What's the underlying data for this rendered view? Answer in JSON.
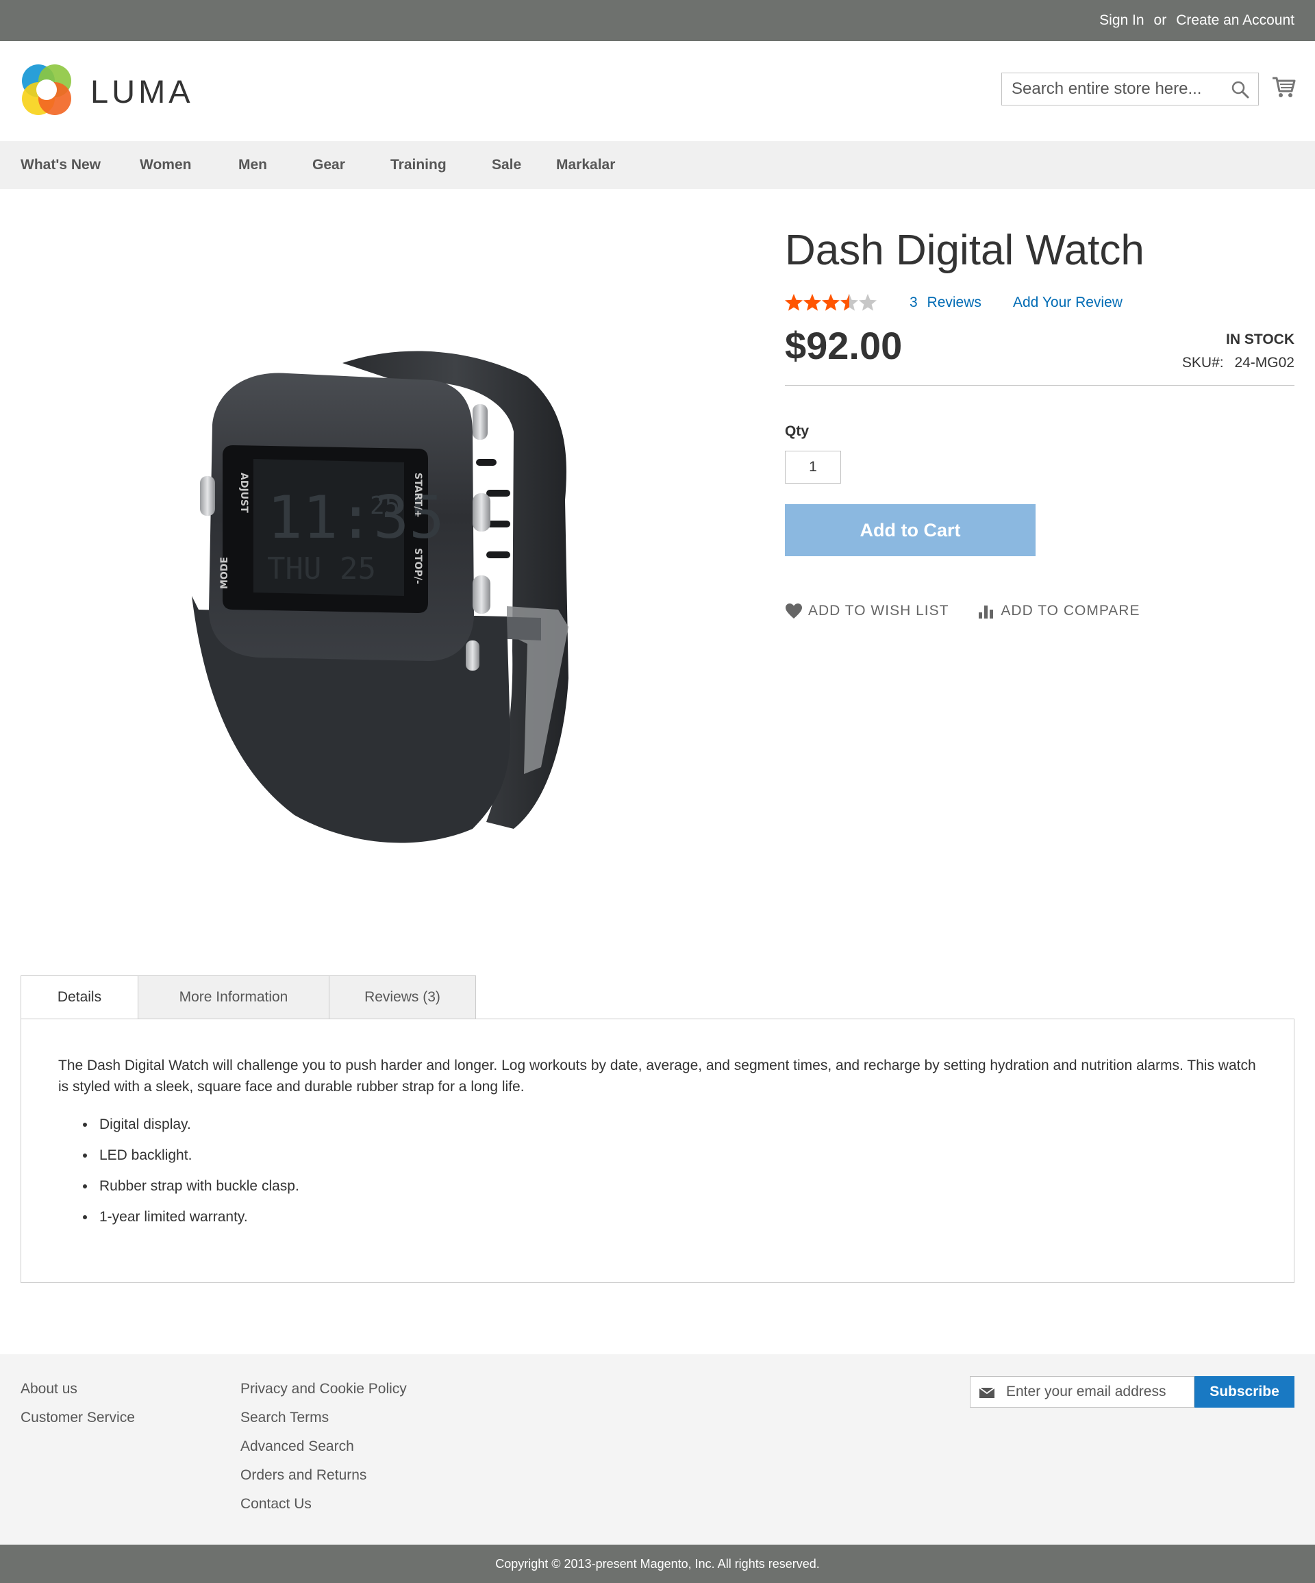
{
  "top_panel": {
    "sign_in": "Sign In",
    "or": "or",
    "create_account": "Create an Account"
  },
  "header": {
    "logo_text": "LUMA",
    "search_placeholder": "Search entire store here...",
    "search_icon": "search-icon",
    "cart_icon": "cart-icon"
  },
  "nav": {
    "items": [
      "What's New",
      "Women",
      "Men",
      "Gear",
      "Training",
      "Sale",
      "Markalar"
    ]
  },
  "product": {
    "title": "Dash Digital Watch",
    "rating_percent": 70,
    "rating_stars": 3.5,
    "reviews_count": "3",
    "reviews_label": "Reviews",
    "add_review": "Add Your Review",
    "price": "$92.00",
    "stock": "In stock",
    "sku_label": "SKU#:",
    "sku": "24-MG02",
    "qty_label": "Qty",
    "qty_value": "1",
    "add_to_cart": "Add to Cart",
    "wishlist": "Add to Wish List",
    "compare": "Add to Compare",
    "image_display": {
      "time": "11:35",
      "seconds": "25",
      "day": "THU 25",
      "label_adjust": "ADJUST",
      "label_mode": "MODE",
      "label_start": "START/+",
      "label_stop": "STOP/-"
    }
  },
  "tabs": {
    "items": [
      "Details",
      "More Information",
      "Reviews (3)"
    ],
    "active": 0
  },
  "details": {
    "description": "The Dash Digital Watch will challenge you to push harder and longer. Log workouts by date, average, and segment times, and recharge by setting hydration and nutrition alarms. This watch is styled with a sleek, square face and durable rubber strap for a long life.",
    "features": [
      "Digital display.",
      "LED backlight.",
      "Rubber strap with buckle clasp.",
      "1-year limited warranty."
    ]
  },
  "footer": {
    "col1": [
      "About us",
      "Customer Service"
    ],
    "col2": [
      "Privacy and Cookie Policy",
      "Search Terms",
      "Advanced Search",
      "Orders and Returns",
      "Contact Us"
    ],
    "newsletter_placeholder": "Enter your email address",
    "subscribe": "Subscribe"
  },
  "copyright": "Copyright © 2013-present Magento, Inc. All rights reserved.",
  "colors": {
    "top_bar": "#6e716e",
    "link": "#006bb4",
    "star": "#ff5501",
    "add_to_cart_bg": "#8bb8e0",
    "subscribe_bg": "#1979c3"
  }
}
